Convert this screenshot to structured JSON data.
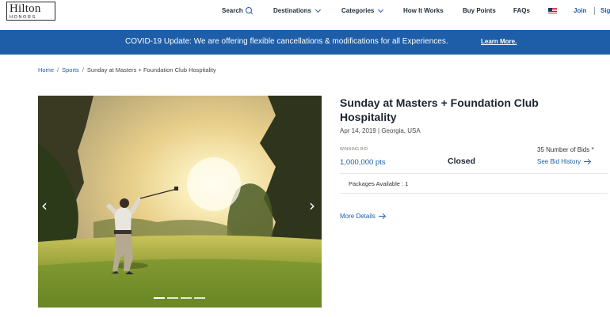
{
  "brand": {
    "name": "Hilton",
    "sub": "HONORS"
  },
  "nav": {
    "search": "Search",
    "destinations": "Destinations",
    "categories": "Categories",
    "how_it_works": "How It Works",
    "buy_points": "Buy Points",
    "faqs": "FAQs",
    "join": "Join",
    "sign_in": "Sig"
  },
  "banner": {
    "text": "COVID-19 Update: We are offering flexible cancellations & modifications for all Experiences.",
    "link": "Learn More."
  },
  "breadcrumb": {
    "home": "Home",
    "sports": "Sports",
    "current": "Sunday at Masters + Foundation Club Hospitality",
    "sep": "/"
  },
  "listing": {
    "title": "Sunday at Masters + Foundation Club Hospitality",
    "meta": "Apr 14, 2019 | Georgia, USA",
    "winning_bid_label": "WINNING BID",
    "winning_bid_value": "1,000,000 pts",
    "status": "Closed",
    "bids_count": "35 Number of Bids *",
    "bid_history": "See Bid History",
    "packages": "Packages Available : 1",
    "more_details": "More Details"
  },
  "carousel": {
    "prev": "‹",
    "next": "›",
    "slides": 4,
    "active_slide": 1
  },
  "colors": {
    "brand_blue": "#1e5ea8",
    "text_dark": "#1d2530"
  }
}
